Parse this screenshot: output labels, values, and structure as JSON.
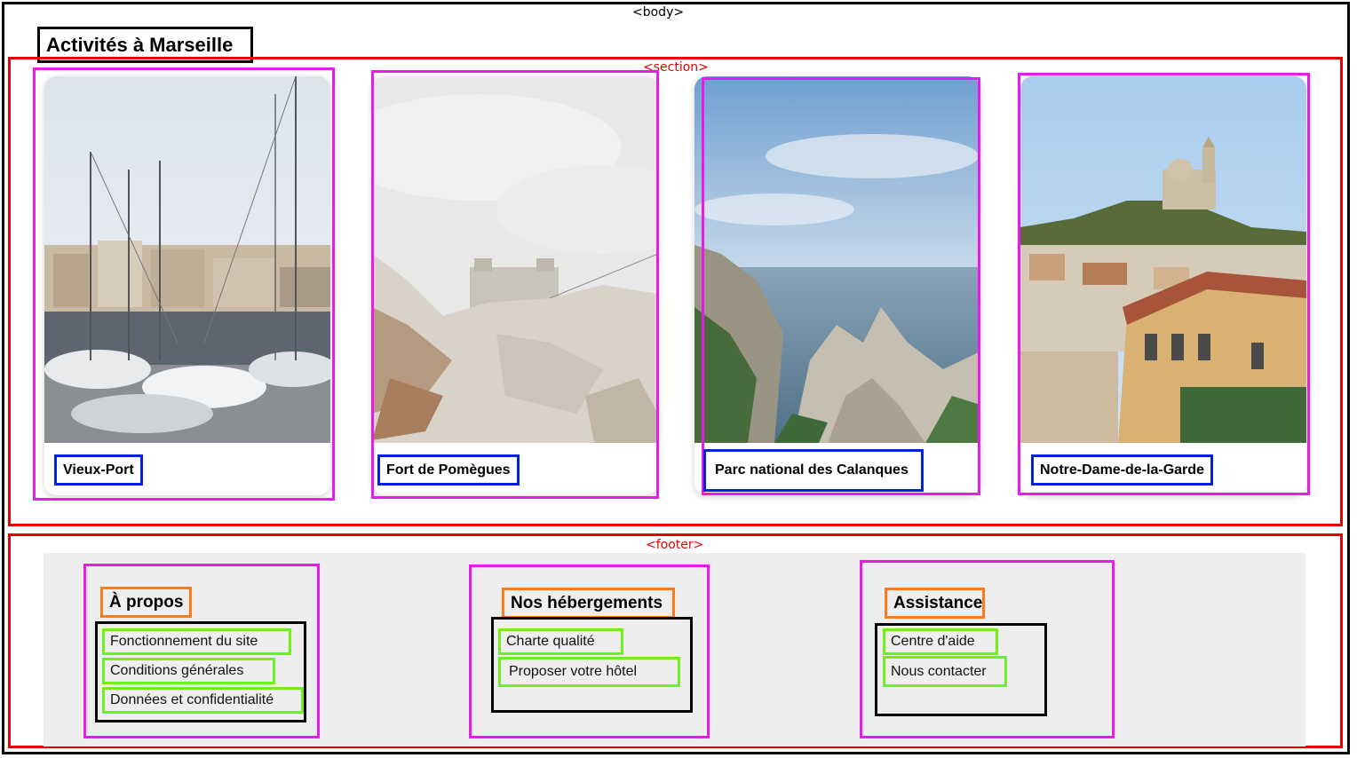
{
  "debug": {
    "body_tag": "<body>",
    "section_tag": "<section>",
    "footer_tag": "<footer>"
  },
  "page": {
    "title": "Activités à Marseille"
  },
  "activities": [
    {
      "label": "Vieux-Port"
    },
    {
      "label": "Fort de Pomègues"
    },
    {
      "label": "Parc national des Calanques"
    },
    {
      "label": "Notre-Dame-de-la-Garde"
    }
  ],
  "footer": {
    "columns": [
      {
        "heading": "À propos",
        "links": [
          "Fonctionnement du site",
          "Conditions générales",
          "Données et confidentialité"
        ]
      },
      {
        "heading": "Nos hébergements",
        "links": [
          "Charte qualité",
          "Proposer votre hôtel"
        ]
      },
      {
        "heading": "Assistance",
        "links": [
          "Centre d'aide",
          "Nous contacter"
        ]
      }
    ]
  },
  "colors": {
    "section_outline": "#e60000",
    "card_outline": "#e81ce8",
    "label_outline": "#0022dd",
    "heading_outline": "#ff7a1a",
    "link_outline": "#6ff01a",
    "footer_bg": "#eeeeee"
  }
}
